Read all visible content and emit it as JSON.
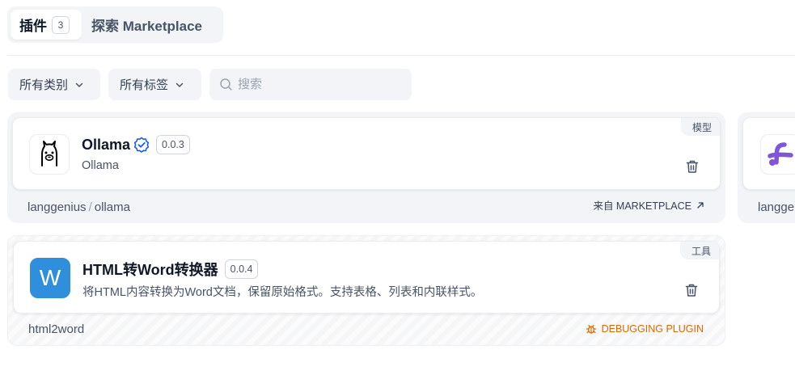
{
  "tabs": [
    {
      "label": "插件",
      "count": "3",
      "active": true
    },
    {
      "label": "探索 Marketplace",
      "active": false
    }
  ],
  "filters": {
    "categories_label": "所有类别",
    "tags_label": "所有标签",
    "search_placeholder": "搜索"
  },
  "plugins": [
    {
      "name": "Ollama",
      "version": "0.0.3",
      "description": "Ollama",
      "category": "模型",
      "author": "langgenius",
      "slug": "ollama",
      "source": "来自 MARKETPLACE",
      "verified": true
    },
    {
      "name": "HTML转Word转换器",
      "version": "0.0.4",
      "description": "将HTML内容转换为Word文档，保留原始格式。支持表格、列表和内联样式。",
      "category": "工具",
      "slug": "html2word",
      "source": "DEBUGGING PLUGIN",
      "icon_letter": "W"
    },
    {
      "author_partial": "langge"
    }
  ],
  "colors": {
    "accent_purple": "#7f56d9",
    "verify_blue": "#155eef",
    "debug_orange": "#dc6803",
    "word_blue": "#2f8fdc"
  }
}
